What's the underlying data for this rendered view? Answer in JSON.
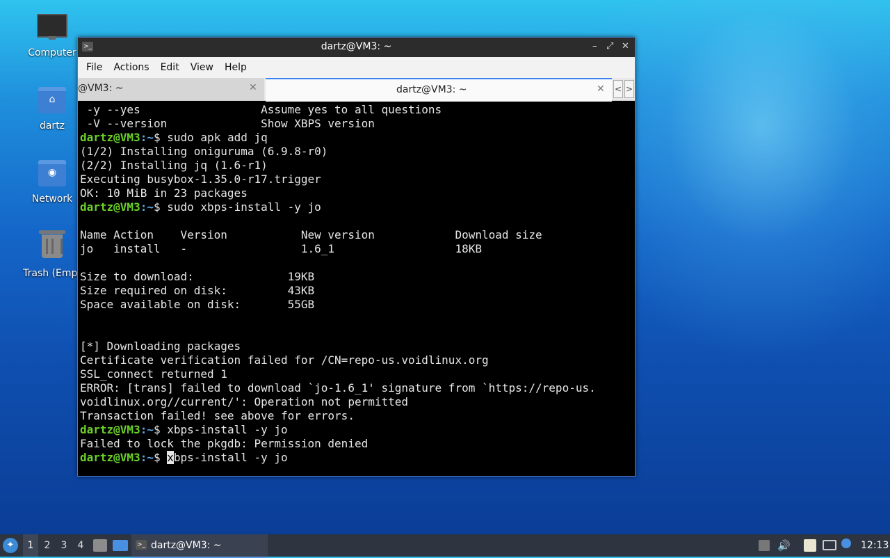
{
  "desktop": {
    "icons": [
      {
        "label": "Computer"
      },
      {
        "label": "dartz"
      },
      {
        "label": "Network"
      },
      {
        "label": "Trash (Empt"
      }
    ]
  },
  "window": {
    "title": "dartz@VM3: ~",
    "controls": {
      "minimize": "–",
      "maximize": "⤢",
      "close": "✕"
    },
    "menu": [
      "File",
      "Actions",
      "Edit",
      "View",
      "Help"
    ],
    "tabs": [
      {
        "label": "@VM3: ~",
        "close": "✕"
      },
      {
        "label": "dartz@VM3: ~",
        "close": "✕"
      }
    ],
    "tab_nav": {
      "prev": "<",
      "next": ">"
    }
  },
  "terminal": {
    "lines": [
      {
        "type": "text",
        "text": " -y --yes                  Assume yes to all questions"
      },
      {
        "type": "text",
        "text": " -V --version              Show XBPS version"
      },
      {
        "type": "prompt",
        "user": "dartz@VM3",
        "path": "~",
        "cmd": " sudo apk add jq"
      },
      {
        "type": "text",
        "text": "(1/2) Installing oniguruma (6.9.8-r0)"
      },
      {
        "type": "text",
        "text": "(2/2) Installing jq (1.6-r1)"
      },
      {
        "type": "text",
        "text": "Executing busybox-1.35.0-r17.trigger"
      },
      {
        "type": "text",
        "text": "OK: 10 MiB in 23 packages"
      },
      {
        "type": "prompt",
        "user": "dartz@VM3",
        "path": "~",
        "cmd": " sudo xbps-install -y jo"
      },
      {
        "type": "text",
        "text": ""
      },
      {
        "type": "text",
        "text": "Name Action    Version           New version            Download size"
      },
      {
        "type": "text",
        "text": "jo   install   -                 1.6_1                  18KB"
      },
      {
        "type": "text",
        "text": ""
      },
      {
        "type": "text",
        "text": "Size to download:              19KB"
      },
      {
        "type": "text",
        "text": "Size required on disk:         43KB"
      },
      {
        "type": "text",
        "text": "Space available on disk:       55GB"
      },
      {
        "type": "text",
        "text": ""
      },
      {
        "type": "text",
        "text": ""
      },
      {
        "type": "text",
        "text": "[*] Downloading packages"
      },
      {
        "type": "text",
        "text": "Certificate verification failed for /CN=repo-us.voidlinux.org"
      },
      {
        "type": "text",
        "text": "SSL_connect returned 1"
      },
      {
        "type": "text",
        "text": "ERROR: [trans] failed to download `jo-1.6_1' signature from `https://repo-us."
      },
      {
        "type": "text",
        "text": "voidlinux.org//current/': Operation not permitted"
      },
      {
        "type": "text",
        "text": "Transaction failed! see above for errors."
      },
      {
        "type": "prompt",
        "user": "dartz@VM3",
        "path": "~",
        "cmd": " xbps-install -y jo"
      },
      {
        "type": "text",
        "text": "Failed to lock the pkgdb: Permission denied"
      },
      {
        "type": "prompt-cursor",
        "user": "dartz@VM3",
        "path": "~",
        "cursor_char": "x",
        "cmd": "bps-install -y jo"
      }
    ]
  },
  "taskbar": {
    "workspaces": [
      "1",
      "2",
      "3",
      "4"
    ],
    "active_workspace": "1",
    "task_label": "dartz@VM3: ~",
    "clock": "12:13"
  }
}
